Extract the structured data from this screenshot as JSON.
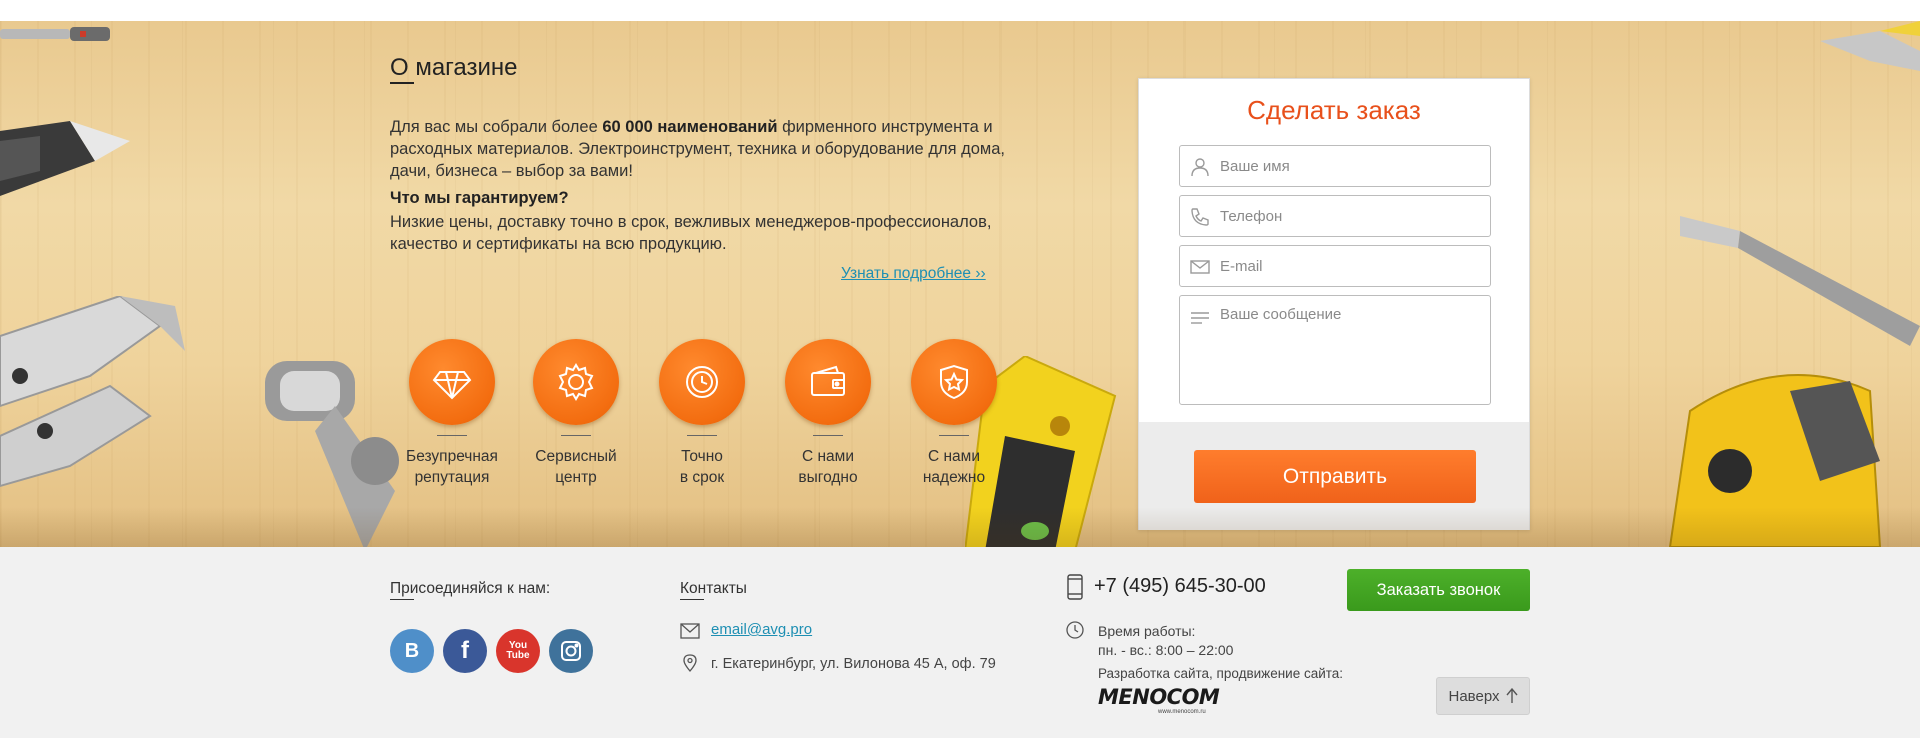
{
  "about": {
    "title": "О магазине",
    "intro_pre": "Для вас мы собрали более ",
    "intro_bold": "60 000 наименований",
    "intro_post": " фирменного инструмента и расходных материалов. Электроинструмент, техника и оборудование для дома, дачи, бизнеса – выбор за вами!",
    "guarantee_title": "Что мы гарантируем?",
    "guarantee_text": "Низкие цены, доставку точно в срок, вежливых менеджеров-профессионалов, качество и сертификаты на всю продукцию.",
    "more_link": "Узнать подробнее ››"
  },
  "features": [
    {
      "line1": "Безупречная",
      "line2": "репутация",
      "icon": "diamond-icon"
    },
    {
      "line1": "Сервисный",
      "line2": "центр",
      "icon": "gear-icon"
    },
    {
      "line1": "Точно",
      "line2": "в срок",
      "icon": "clock-icon"
    },
    {
      "line1": "С нами",
      "line2": "выгодно",
      "icon": "wallet-icon"
    },
    {
      "line1": "С нами",
      "line2": "надежно",
      "icon": "shield-star-icon"
    }
  ],
  "order_form": {
    "title": "Сделать заказ",
    "name_placeholder": "Ваше имя",
    "phone_placeholder": "Телефон",
    "email_placeholder": "E-mail",
    "message_placeholder": "Ваше сообщение",
    "submit_label": "Отправить"
  },
  "footer": {
    "join_heading": "Присоединяйся к нам:",
    "social": [
      {
        "label": "B",
        "color": "#4f8fc9"
      },
      {
        "label": "f",
        "color": "#3b5998"
      },
      {
        "label": "You\nTube",
        "color": "#d9352c"
      },
      {
        "label": "ig",
        "color": "#3f729b"
      }
    ],
    "contacts_heading": "Контакты",
    "email": "email@avg.pro",
    "address": "г. Екатеринбург, ул. Вилонова 45 А, оф. 79",
    "phone": "+7 (495) 645-30-00",
    "callback_label": "Заказать звонок",
    "hours_label": "Время работы:",
    "hours_value": "пн. - вс.: 8:00 – 22:00",
    "dev_label": "Разработка сайта, продвижение сайта:",
    "dev_logo": "MENOCOM",
    "dev_logo_sub": "www.menocom.ru",
    "top_label": "Наверх"
  },
  "colors": {
    "accent_orange": "#f36d10",
    "title_red": "#e8501b",
    "link_blue": "#1e8fb3",
    "callback_green": "#3a9a1c"
  }
}
